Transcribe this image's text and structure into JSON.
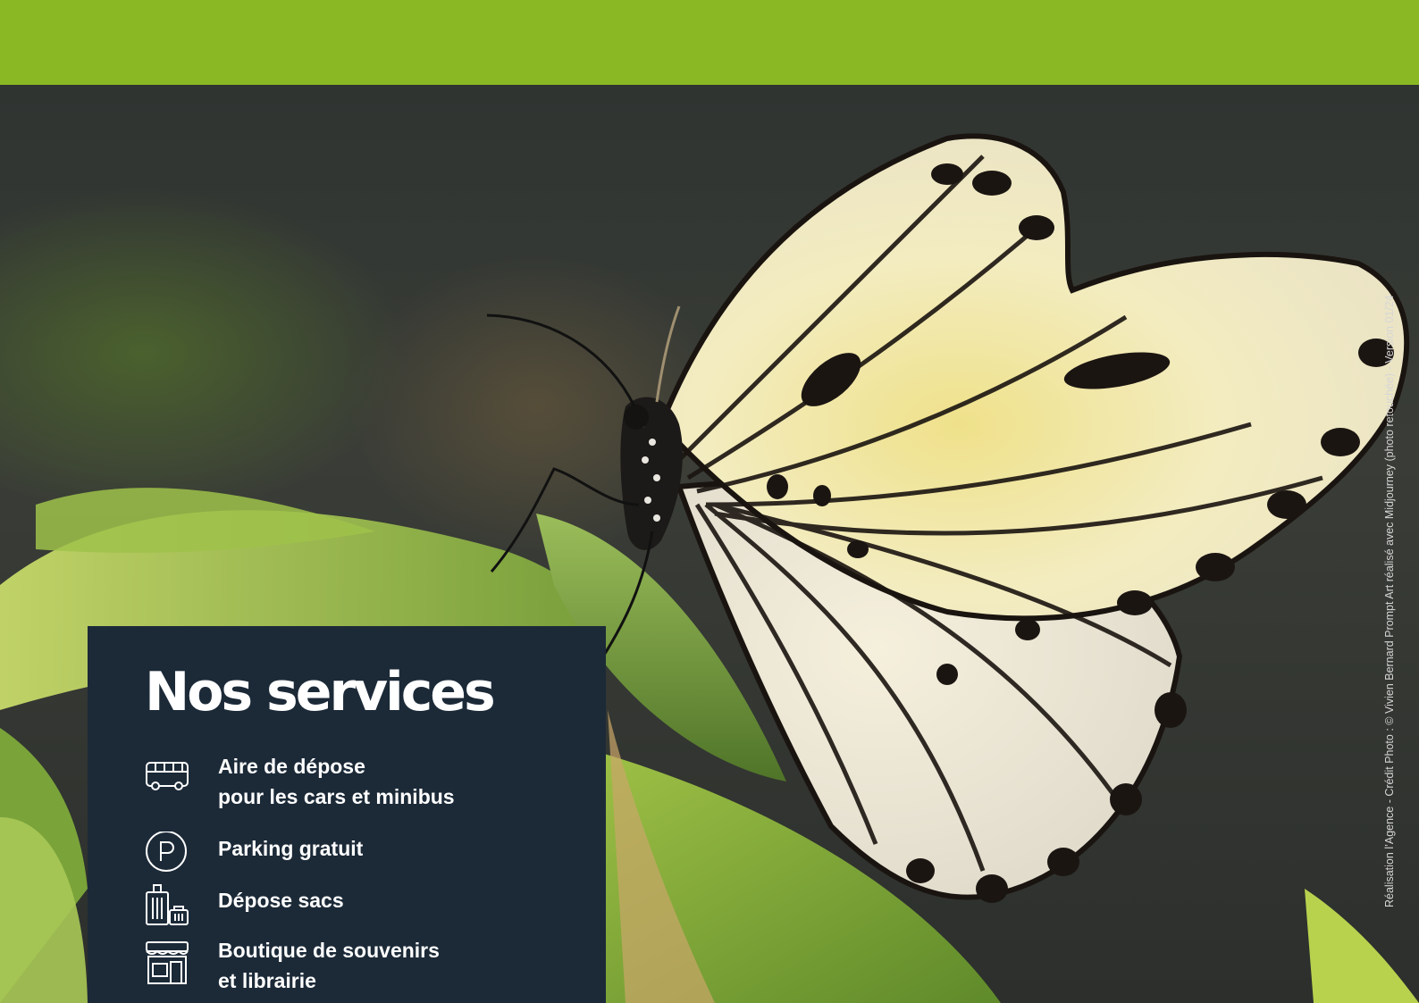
{
  "colors": {
    "top_bar": "#8ab825",
    "panel": "#1c2a38",
    "text": "#ffffff"
  },
  "photo": {
    "subject": "butterfly-photo"
  },
  "credit": "Réalisation l’Agence - Crédit Photo : © Vivien Bernard Prompt Art réalisé avec Midjourney (photo retouchée) - Version 01/24",
  "services": {
    "title": "Nos services",
    "items": [
      {
        "icon": "bus-icon",
        "line1": "Aire de dépose",
        "line2": "pour les cars et minibus"
      },
      {
        "icon": "parking-icon",
        "line1": "Parking gratuit",
        "line2": ""
      },
      {
        "icon": "luggage-icon",
        "line1": "Dépose sacs",
        "line2": ""
      },
      {
        "icon": "shop-icon",
        "line1": "Boutique de souvenirs",
        "line2": "et librairie"
      }
    ]
  }
}
